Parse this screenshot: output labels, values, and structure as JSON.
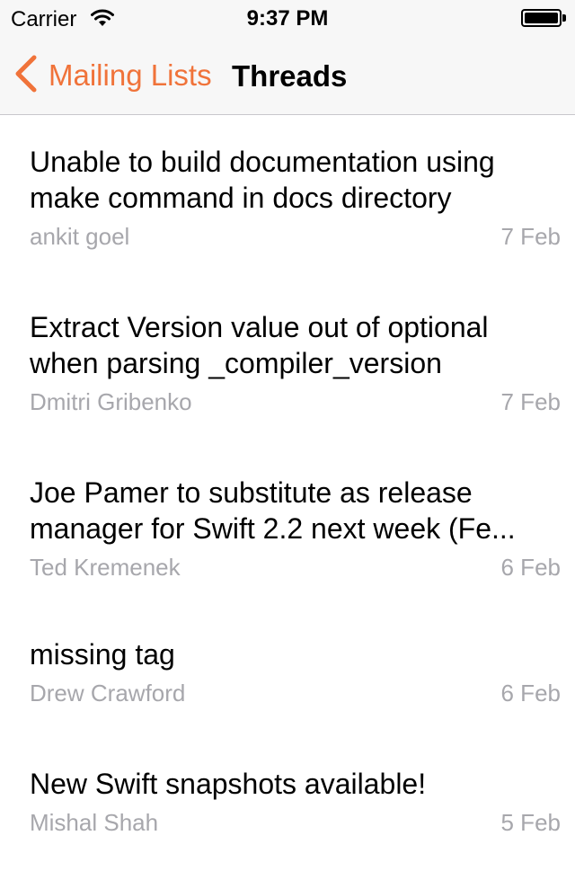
{
  "status_bar": {
    "carrier": "Carrier",
    "time": "9:37 PM"
  },
  "nav": {
    "back_label": "Mailing Lists",
    "title": "Threads",
    "accent_color": "#f0733a"
  },
  "threads": [
    {
      "subject_line1": "Unable to build documentation using",
      "subject_line2": "make command in docs directory",
      "author": "ankit goel",
      "date": "7 Feb"
    },
    {
      "subject_line1": "Extract Version value out of optional",
      "subject_line2": "when parsing _compiler_version",
      "author": "Dmitri Gribenko",
      "date": "7 Feb"
    },
    {
      "subject_line1": "Joe Pamer to substitute as release",
      "subject_line2": "manager for Swift 2.2 next week (Fe...",
      "author": "Ted Kremenek",
      "date": "6 Feb"
    },
    {
      "subject_line1": "missing tag",
      "author": "Drew Crawford",
      "date": "6 Feb"
    },
    {
      "subject_line1": "New Swift snapshots available!",
      "author": "Mishal Shah",
      "date": "5 Feb"
    }
  ]
}
